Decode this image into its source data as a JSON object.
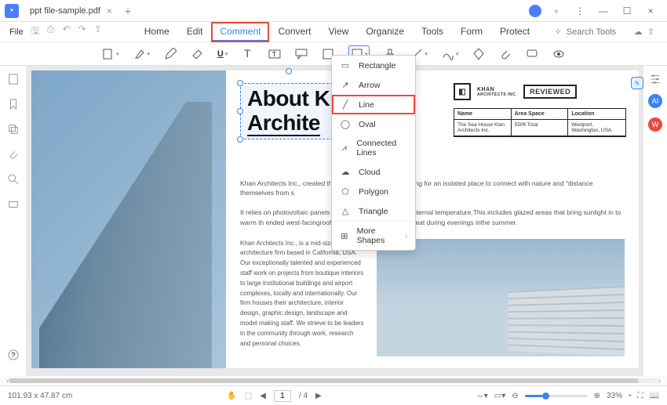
{
  "titlebar": {
    "tab_name": "ppt file-sample.pdf"
  },
  "menubar": {
    "file": "File",
    "tabs": [
      "Home",
      "Edit",
      "Comment",
      "Convert",
      "View",
      "Organize",
      "Tools",
      "Form",
      "Protect"
    ],
    "active_tab": "Comment",
    "search_placeholder": "Search Tools"
  },
  "shape_menu": {
    "items": [
      "Rectangle",
      "Arrow",
      "Line",
      "Oval",
      "Connected Lines",
      "Cloud",
      "Polygon",
      "Triangle"
    ],
    "more": "More Shapes",
    "highlighted": "Line"
  },
  "document": {
    "title_line1": "About K",
    "title_line2": "Archite",
    "logo_brand": "KHAN",
    "logo_sub": "ARCHITECTS INC.",
    "reviewed": "REVIEWED",
    "info": {
      "h1": "Name",
      "h2": "Area Space",
      "h3": "Location",
      "v1": "The Sea House Klan Architects Inc.",
      "v2": "550ft Total",
      "v3": "Westport, Washington, USA"
    },
    "p1": "Khan Architects Inc., created thi                                           ashington for a family looking for an isolated place to connect with nature and \"distance themselves from s",
    "p2": "It relies on photovoltaic panels fo                                         g designs to regulate its internal temperature.This includes glazed areas that bring sunlight in to warm th                                           ended west-facingroof provides shade from solar heat during evenings inthe summer.",
    "p3": "Khan Architects Inc., is a mid-sized architecture firm based in California, USA. Our exceptionally talented and experienced staff work on projects from boutique interiors to large institutional buildings and airport complexes, locally and internationally. Our firm houses their architecture, interior design, graphic design, landscape and model making staff. We strieve to be leaders in the community through work, research and personal choices."
  },
  "statusbar": {
    "dimensions": "101.93 x 47.87 cm",
    "page_current": "1",
    "page_total": "/ 4",
    "zoom": "33%"
  }
}
